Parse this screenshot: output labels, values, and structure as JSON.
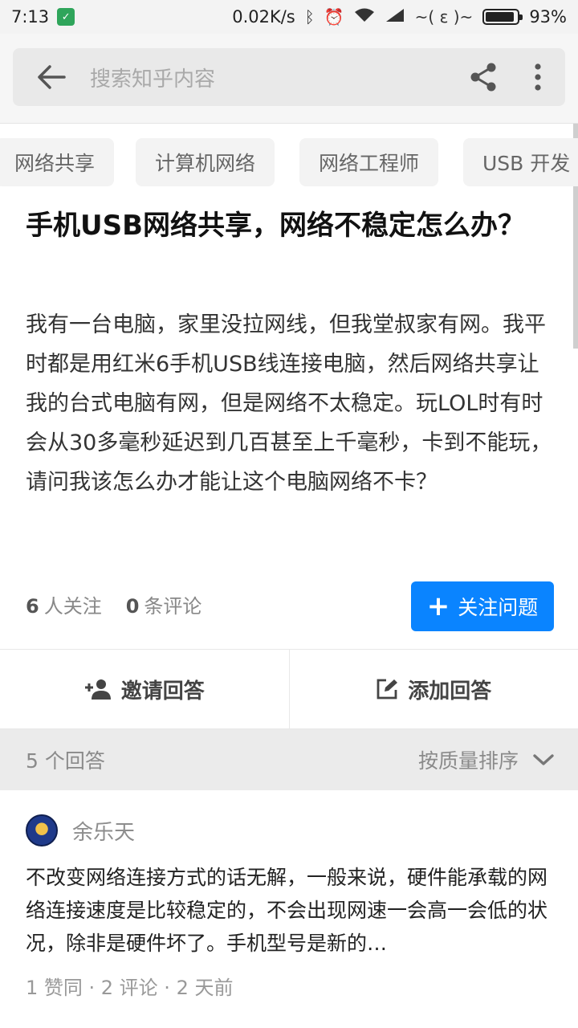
{
  "status_bar": {
    "time": "7:13",
    "speed": "0.02K/s",
    "carrier_glyphs": "~(  ε  )~",
    "battery_percent": "93%",
    "battery_level": 0.93
  },
  "search": {
    "placeholder": "搜索知乎内容"
  },
  "tags": [
    "网络共享",
    "计算机网络",
    "网络工程师",
    "USB 开发"
  ],
  "question": {
    "title": "手机USB网络共享，网络不稳定怎么办？",
    "body": "我有一台电脑，家里没拉网线，但我堂叔家有网。我平时都是用红米6手机USB线连接电脑，然后网络共享让我的台式电脑有网，但是网络不太稳定。玩LOL时有时会从30多毫秒延迟到几百甚至上千毫秒，卡到不能玩，请问我该怎么办才能让这个电脑网络不卡？",
    "followers_count": "6",
    "followers_label": "人关注",
    "comments_count": "0",
    "comments_label": "条评论",
    "follow_button": "关注问题"
  },
  "actions": {
    "invite": "邀请回答",
    "add": "添加回答"
  },
  "answers_header": {
    "count_label": "5 个回答",
    "sort_label": "按质量排序"
  },
  "answer": {
    "author": "余乐天",
    "excerpt": "不改变网络连接方式的话无解，一般来说，硬件能承载的网络连接速度是比较稳定的，不会出现网速一会高一会低的状况，除非是硬件坏了。手机型号是新的…",
    "meta": "1 赞同 · 2 评论 · 2 天前"
  },
  "colors": {
    "accent": "#0a84ff",
    "status_shield": "#2fa55b"
  }
}
